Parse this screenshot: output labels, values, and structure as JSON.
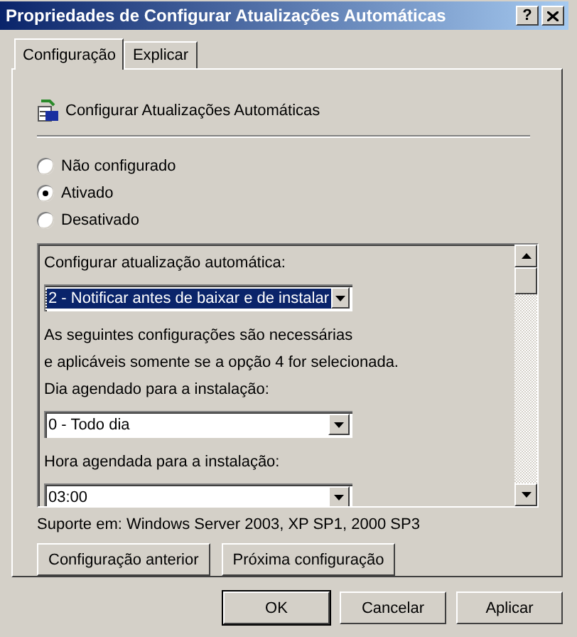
{
  "window": {
    "title": "Propriedades de Configurar Atualizações Automáticas",
    "help": "?"
  },
  "tabs": [
    {
      "label": "Configuração",
      "selected": true
    },
    {
      "label": "Explicar",
      "selected": false
    }
  ],
  "policy": {
    "title": "Configurar Atualizações Automáticas"
  },
  "radios": [
    {
      "label": "Não configurado",
      "selected": false
    },
    {
      "label": "Ativado",
      "selected": true
    },
    {
      "label": "Desativado",
      "selected": false
    }
  ],
  "options": [
    {
      "kind": "label",
      "text": "Configurar atualização automática:"
    },
    {
      "kind": "dropdown",
      "value": "2 - Notificar antes de baixar e de instalar",
      "focused": true
    },
    {
      "kind": "text",
      "text": "As seguintes configurações são necessárias"
    },
    {
      "kind": "text",
      "text": "e aplicáveis somente se a opção 4 for selecionada."
    },
    {
      "kind": "label",
      "text": "Dia agendado para a instalação:"
    },
    {
      "kind": "dropdown",
      "value": "0 - Todo dia",
      "focused": false
    },
    {
      "kind": "label",
      "text": "Hora agendada para a instalação:"
    },
    {
      "kind": "dropdown",
      "value": "03:00",
      "focused": false
    }
  ],
  "support": "Suporte em: Windows Server 2003, XP SP1, 2000 SP3",
  "nav_buttons": [
    "Configuração anterior",
    "Próxima configuração"
  ],
  "dialog_buttons": [
    {
      "label": "OK",
      "default": true
    },
    {
      "label": "Cancelar",
      "default": false
    },
    {
      "label": "Aplicar",
      "default": false
    }
  ]
}
